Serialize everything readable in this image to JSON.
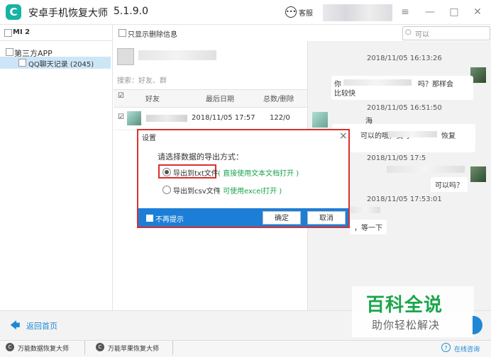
{
  "app": {
    "logo_glyph": "C",
    "title": "安卓手机恢复大师",
    "version": "5.1.9.0",
    "service_label": "客服",
    "service_icon": "chat-bubble-icon"
  },
  "window": {
    "menu_glyph": "≡",
    "minimize_glyph": "—",
    "maximize_glyph": "□",
    "close_glyph": "✕"
  },
  "left": {
    "device": "MI 2",
    "third_party": "第三方APP",
    "qq_item": "QQ聊天记录 (2045)"
  },
  "middle": {
    "filter_label": "只显示删除信息",
    "search_placeholder": "搜索：好友、群",
    "columns": [
      "好友",
      "最后日期",
      "总数/删除"
    ],
    "row": {
      "date": "2018/11/05 17:57",
      "total": "122/0"
    }
  },
  "top_search": {
    "placeholder": "可以"
  },
  "chat": {
    "ts1": "2018/11/05 16:13:26",
    "msg1_a": "你",
    "msg1_b": "吗？那样会",
    "msg1_c": "比较快",
    "ts2": "2018/11/05 16:51:50",
    "msg2_a": "海",
    "msg2_b": "可以的哦，我可",
    "msg2_c": "恢复",
    "ts3": "2018/11/05 17:5",
    "msg3": "可以吗？",
    "ts4": "2018/11/05 17:53:01",
    "msg4": "，等一下"
  },
  "dialog": {
    "title": "设置",
    "close_glyph": "×",
    "prompt": "请选择数据的导出方式：",
    "opt1_label": "导出到txt文件",
    "opt1_hint": "( 直接使用文本文档打开 )",
    "opt2_label": "导出到csv文件",
    "opt2_hint": "( 可使用excel打开 )",
    "no_prompt": "不再提示",
    "ok": "确定",
    "cancel": "取消"
  },
  "bottom": {
    "back": "返回首页",
    "back_icon_glyph": "🡄"
  },
  "footer": {
    "link1": "万能数据恢复大师",
    "link2": "万能苹果恢复大师",
    "consult": "在线咨询",
    "consult_icon_glyph": "?"
  },
  "watermark": {
    "main": "百科全说",
    "sub": "助你轻松解决"
  }
}
